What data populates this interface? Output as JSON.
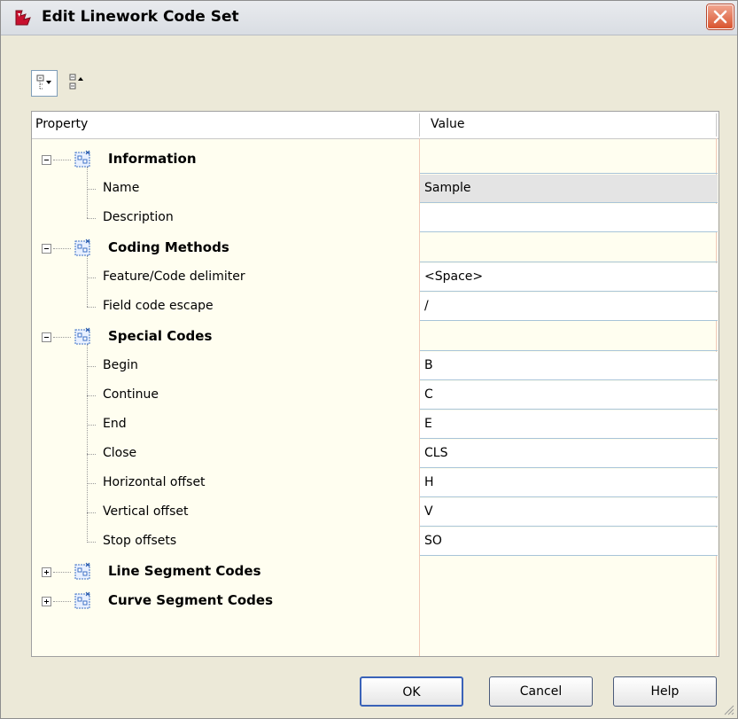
{
  "window": {
    "title": "Edit Linework Code Set"
  },
  "toolbar": {
    "categorized_icon": "categorized-view-icon",
    "alphabetical_icon": "alphabetical-view-icon"
  },
  "columns": {
    "property": "Property",
    "value": "Value"
  },
  "groups": [
    {
      "label": "Information",
      "expanded": true,
      "rows": [
        {
          "label": "Name",
          "value": "Sample",
          "readonly": true
        },
        {
          "label": "Description",
          "value": ""
        }
      ]
    },
    {
      "label": "Coding Methods",
      "expanded": true,
      "rows": [
        {
          "label": "Feature/Code delimiter",
          "value": "<Space>"
        },
        {
          "label": "Field code escape",
          "value": "/"
        }
      ]
    },
    {
      "label": "Special Codes",
      "expanded": true,
      "rows": [
        {
          "label": "Begin",
          "value": "B"
        },
        {
          "label": "Continue",
          "value": "C"
        },
        {
          "label": "End",
          "value": "E"
        },
        {
          "label": "Close",
          "value": "CLS"
        },
        {
          "label": "Horizontal offset",
          "value": "H"
        },
        {
          "label": "Vertical offset",
          "value": "V"
        },
        {
          "label": "Stop offsets",
          "value": "SO"
        }
      ]
    },
    {
      "label": "Line Segment Codes",
      "expanded": false,
      "rows": []
    },
    {
      "label": "Curve Segment Codes",
      "expanded": false,
      "rows": []
    }
  ],
  "buttons": {
    "ok": "OK",
    "cancel": "Cancel",
    "help": "Help"
  },
  "colors": {
    "grid_bg": "#fffef0",
    "title_bg": "#e4e7eb",
    "close_bg": "#d9542f"
  }
}
